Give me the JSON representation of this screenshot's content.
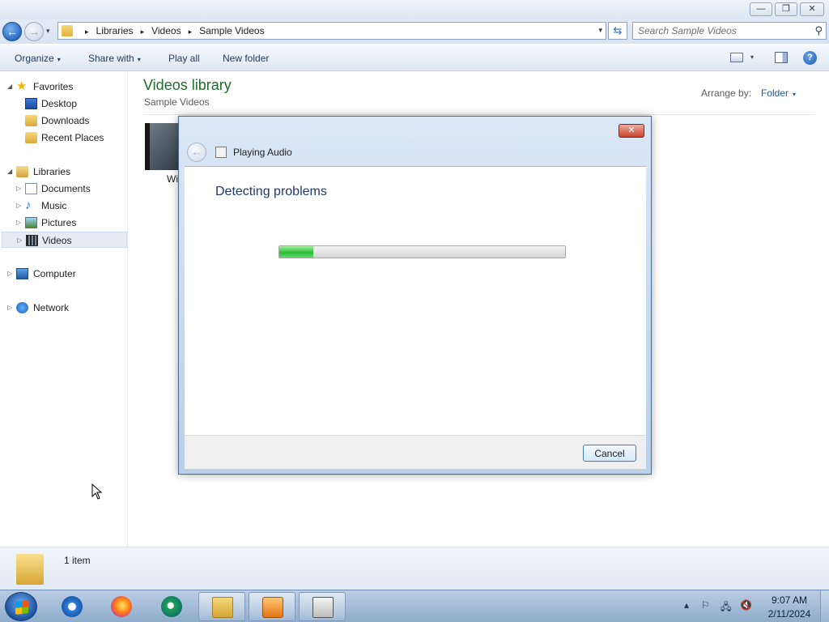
{
  "explorer": {
    "caption_buttons": {
      "minimize": "—",
      "maximize": "❐",
      "close": "✕"
    },
    "nav": {
      "back_glyph": "←",
      "forward_glyph": "→"
    },
    "breadcrumbs": [
      "Libraries",
      "Videos",
      "Sample Videos"
    ],
    "breadcrumb_separator": "▸",
    "search": {
      "placeholder": "Search Sample Videos"
    },
    "toolbar": {
      "organize": "Organize",
      "share_with": "Share with",
      "play_all": "Play all",
      "new_folder": "New folder",
      "dropdown_glyph": "▾"
    },
    "navpane": {
      "favorites": {
        "label": "Favorites",
        "items": [
          "Desktop",
          "Downloads",
          "Recent Places"
        ]
      },
      "libraries": {
        "label": "Libraries",
        "items": [
          "Documents",
          "Music",
          "Pictures",
          "Videos"
        ]
      },
      "computer": "Computer",
      "network": "Network",
      "expanded_glyph": "◢",
      "collapsed_glyph": "▷"
    },
    "content": {
      "title": "Videos library",
      "subtitle": "Sample Videos",
      "arrange_label": "Arrange by:",
      "arrange_value": "Folder",
      "item_name_partial": "Wi"
    },
    "details": {
      "count": "1 item"
    }
  },
  "dialog": {
    "title": "Playing Audio",
    "heading": "Detecting problems",
    "close_glyph": "✕",
    "back_glyph": "←",
    "progress_fraction": 0.12,
    "cancel_label": "Cancel"
  },
  "taskbar": {
    "apps": [
      "internet-explorer",
      "firefox",
      "chrome",
      "windows-explorer",
      "windows-media-player",
      "troubleshooter"
    ],
    "tray": {
      "expand_glyph": "▴",
      "flag_glyph": "⚐",
      "network_glyph": "🖧",
      "volume_glyph": "🔇"
    },
    "clock": {
      "time": "9:07 AM",
      "date": "2/11/2024"
    }
  },
  "colors": {
    "library_title": "#1e6b2d",
    "link_blue": "#1e5aa8",
    "dialog_heading": "#1e3a6b",
    "progress_green": "#2cbd3a"
  }
}
